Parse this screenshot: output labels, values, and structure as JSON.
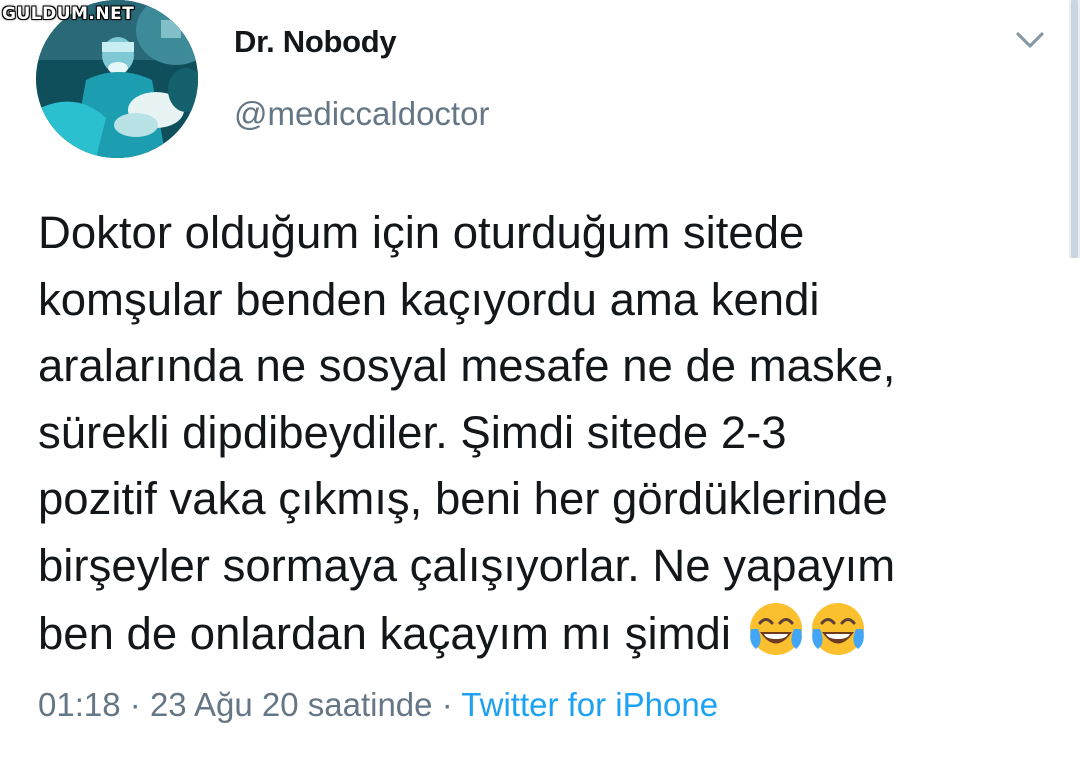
{
  "watermark": "GULDUM.NET",
  "tweet": {
    "author": {
      "display_name": "Dr. Nobody",
      "handle": "@mediccaldoctor"
    },
    "text_lines": [
      "Doktor olduğum için oturduğum sitede",
      "komşular benden kaçıyordu ama kendi",
      "aralarında ne sosyal mesafe ne de maske,",
      "sürekli dipdibeydiler. Şimdi sitede 2-3",
      "pozitif vaka çıkmış, beni her gördüklerinde",
      "birşeyler sormaya çalışıyorlar. Ne yapayım",
      "ben de onlardan kaçayım mı şimdi"
    ],
    "emoji": [
      "tears-of-joy-emoji",
      "tears-of-joy-emoji"
    ],
    "time": "01:18",
    "separator": "·",
    "date": "23 Ağu 20 saatinde",
    "source": "Twitter for iPhone"
  },
  "colors": {
    "text": "#14171a",
    "secondary": "#657786",
    "link": "#1da1f2",
    "background": "#ffffff"
  },
  "icons": {
    "menu": "chevron-down-icon"
  }
}
